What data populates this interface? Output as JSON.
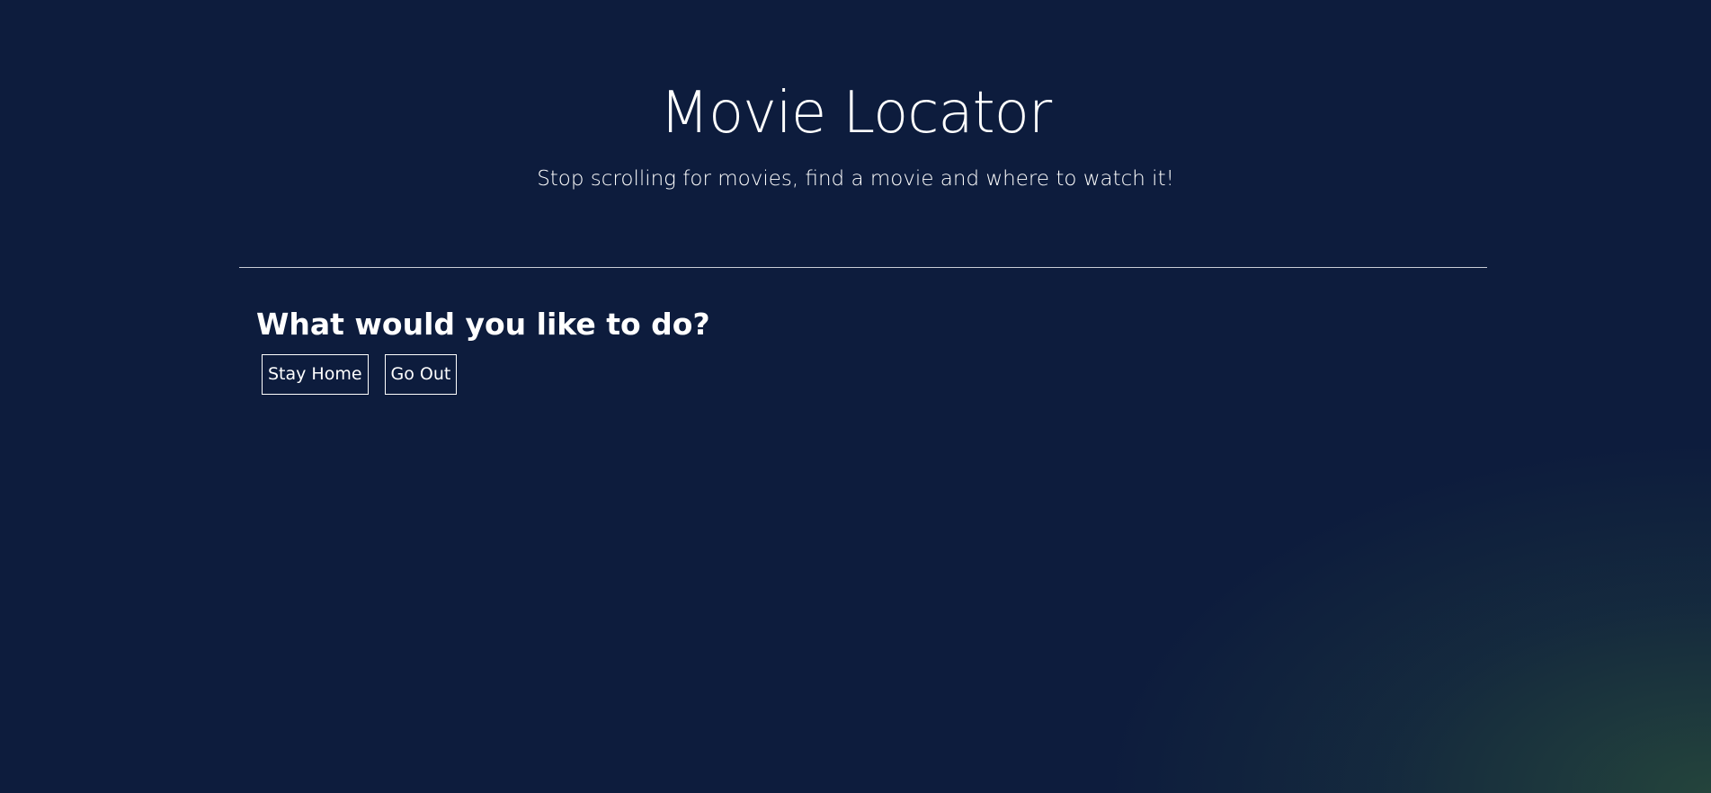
{
  "header": {
    "title": "Movie Locator",
    "subtitle": "Stop scrolling for movies, find a movie and where to watch it!"
  },
  "main": {
    "question": "What would you like to do?",
    "options": [
      {
        "label": "Stay Home"
      },
      {
        "label": "Go Out"
      }
    ]
  },
  "colors": {
    "background": "#0d1c3d",
    "text": "#ffffff",
    "divider": "#c8ccd6",
    "corner_glow": "#284b3c"
  }
}
